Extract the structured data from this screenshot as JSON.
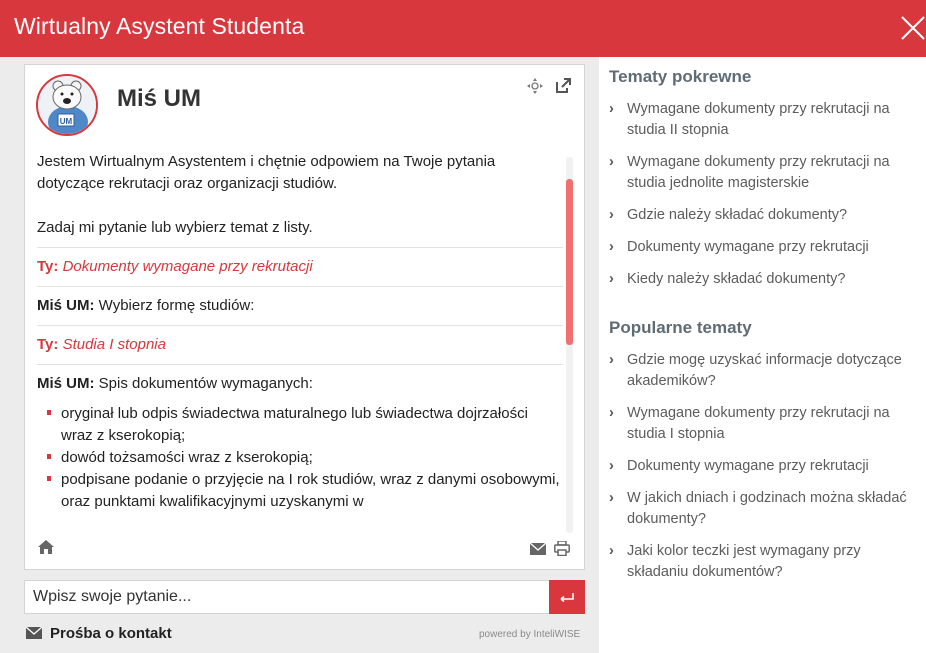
{
  "window": {
    "title": "Wirtualny Asystent Studenta"
  },
  "chat": {
    "bot_name": "Miś UM",
    "avatar_text": "UM",
    "intro_1": "Jestem Wirtualnym Asystentem i chętnie odpowiem na Twoje pytania dotyczące rekrutacji oraz organizacji studiów.",
    "intro_2": "Zadaj mi pytanie lub wybierz temat z listy.",
    "messages": [
      {
        "who": "Ty:",
        "text": "Dokumenty wymagane przy rekrutacji"
      },
      {
        "who": "Miś UM:",
        "text": "Wybierz formę studiów:"
      },
      {
        "who": "Ty:",
        "text": "Studia I stopnia"
      },
      {
        "who": "Miś UM:",
        "text": "Spis dokumentów wymaganych:"
      }
    ],
    "documents": [
      "oryginał lub odpis świadectwa maturalnego lub świadectwa dojrzałości wraz z kserokopią;",
      "dowód tożsamości wraz z kserokopią;",
      "podpisane podanie o przyjęcie na I rok studiów, wraz z danymi osobowymi, oraz punktami kwalifikacyjnymi uzyskanymi w"
    ]
  },
  "input": {
    "placeholder": "Wpisz swoje pytanie..."
  },
  "footer": {
    "contact_label": "Prośba o kontakt",
    "powered_by": "powered by InteliWISE"
  },
  "related": {
    "title": "Tematy pokrewne",
    "items": [
      "Wymagane dokumenty przy rekrutacji na studia II stopnia",
      "Wymagane dokumenty przy rekrutacji na studia jednolite magisterskie",
      "Gdzie należy składać dokumenty?",
      "Dokumenty wymagane przy rekrutacji",
      "Kiedy należy składać dokumenty?"
    ]
  },
  "popular": {
    "title": "Popularne tematy",
    "items": [
      "Gdzie mogę uzyskać informacje dotyczące akademików?",
      "Wymagane dokumenty przy rekrutacji na studia I stopnia",
      "Dokumenty wymagane przy rekrutacji",
      "W jakich dniach i godzinach można składać dokumenty?",
      "Jaki kolor teczki jest wymagany przy składaniu dokumentów?"
    ]
  },
  "colors": {
    "accent": "#d8373d",
    "heading": "#5f6b75",
    "panel": "#ececec"
  },
  "icons": [
    "close-icon",
    "move-icon",
    "popout-icon",
    "home-icon",
    "mail-icon",
    "print-icon",
    "send-icon",
    "bear-avatar"
  ]
}
